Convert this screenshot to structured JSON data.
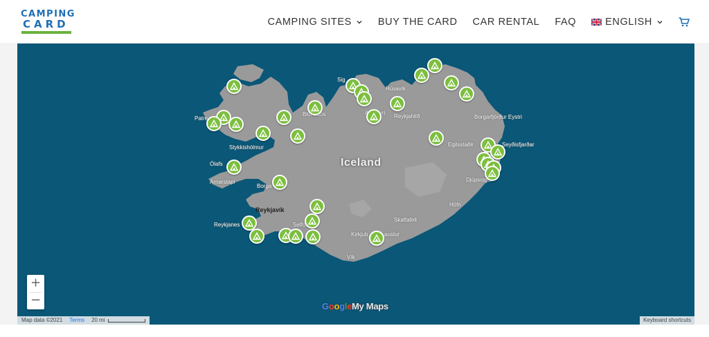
{
  "brand": {
    "line1": "CAMPING",
    "line2": "CARD"
  },
  "nav": {
    "items": [
      {
        "label": "CAMPING SITES",
        "has_dropdown": true
      },
      {
        "label": "BUY THE CARD",
        "has_dropdown": false
      },
      {
        "label": "CAR RENTAL",
        "has_dropdown": false
      },
      {
        "label": "FAQ",
        "has_dropdown": false
      }
    ],
    "language": "ENGLISH",
    "cart_icon": "cart-icon"
  },
  "map": {
    "country_label": "Iceland",
    "places": [
      "Patre",
      "Stykkishólmur",
      "Ólafs",
      "Arnarstapi",
      "Borga",
      "Reykjavík",
      "Reykjanes",
      "Selfoss",
      "Kirkjub",
      "austur",
      "Skaftafell",
      "Vík",
      "Höfn",
      "Djúpivogur",
      "Egilsstaðir",
      "Seyðisfjarðar",
      "Borgarfjörður Eystri",
      "Húsavík",
      "Reykjahlíð",
      "Blönduós",
      "Sig",
      "Akureyri",
      "fjur"
    ],
    "zoom_in": "+",
    "zoom_out": "−",
    "brand_google": "Google",
    "brand_mymaps": "My Maps",
    "attribution": "Map data ©2021",
    "terms": "Terms",
    "scale": "20 mi",
    "keyboard_shortcuts": "Keyboard shortcuts",
    "marker_icon": "tent-icon",
    "marker_color": "#7cbf3e",
    "water_color": "#0a5777",
    "land_color": "#9a9a9a"
  }
}
